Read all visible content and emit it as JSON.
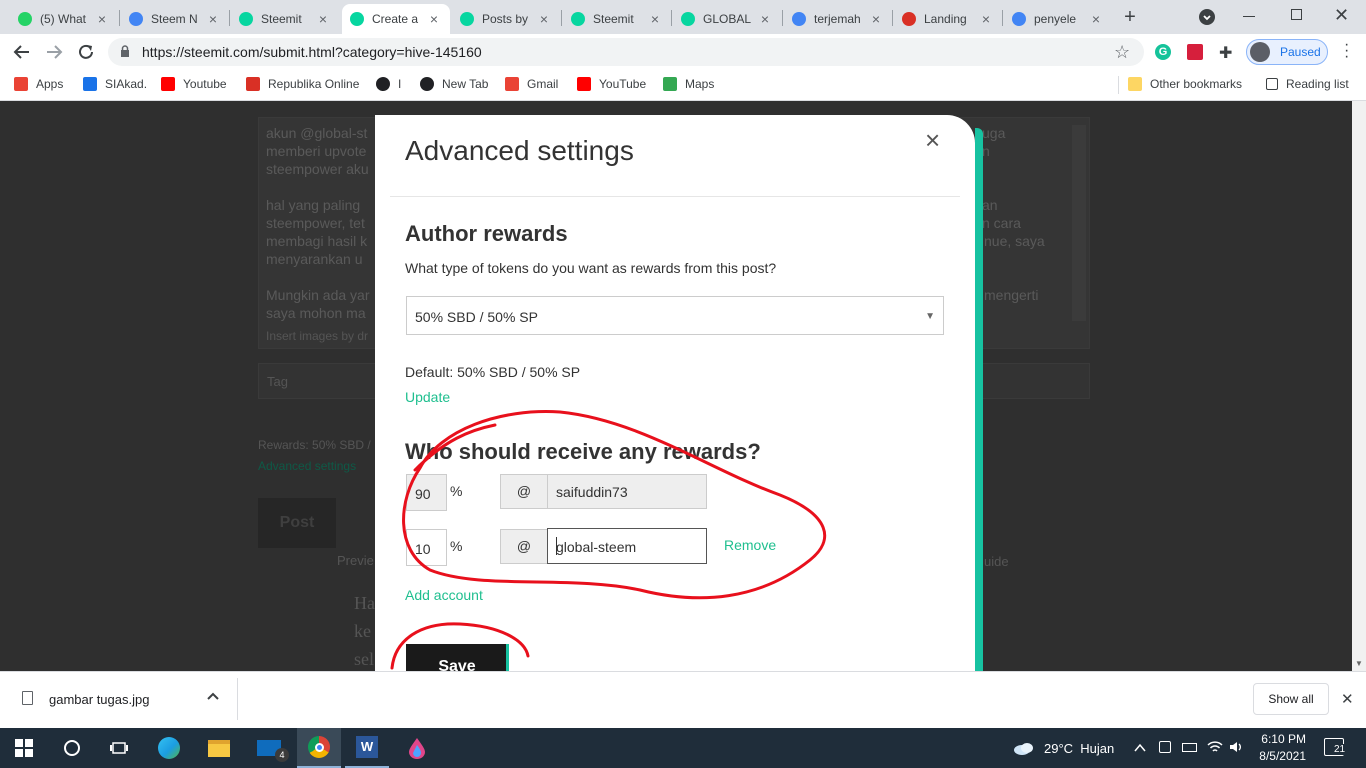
{
  "browser": {
    "tabs": [
      {
        "title": "(5) What",
        "icon": "whatsapp-icon",
        "color": "#25d366",
        "active": false
      },
      {
        "title": "Steem N",
        "icon": "docs-icon",
        "color": "#4285f4",
        "active": false
      },
      {
        "title": "Steemit",
        "icon": "steemit-icon",
        "color": "#07d6a0",
        "active": false
      },
      {
        "title": "Create a",
        "icon": "steemit-icon",
        "color": "#07d6a0",
        "active": true
      },
      {
        "title": "Posts by",
        "icon": "steemit-icon",
        "color": "#07d6a0",
        "active": false
      },
      {
        "title": "Steemit",
        "icon": "steemit-icon",
        "color": "#07d6a0",
        "active": false
      },
      {
        "title": "GLOBAL",
        "icon": "steemit-icon",
        "color": "#07d6a0",
        "active": false
      },
      {
        "title": "terjemah",
        "icon": "google-icon",
        "color": "#4285f4",
        "active": false
      },
      {
        "title": "Landing",
        "icon": "wifi-icon",
        "color": "#d93025",
        "active": false
      },
      {
        "title": "penyele",
        "icon": "google-icon",
        "color": "#4285f4",
        "active": false
      }
    ],
    "new_tab": "+",
    "url": "https://steemit.com/submit.html?category=hive-145160",
    "profile_status": "Paused",
    "bookmarks": [
      {
        "label": "Apps",
        "icon": "apps-icon",
        "color": "#ea4335"
      },
      {
        "label": "SIAkad.",
        "icon": "siakad-icon",
        "color": "#1a73e8"
      },
      {
        "label": "Youtube",
        "icon": "youtube-icon",
        "color": "#ff0000"
      },
      {
        "label": "Republika Online",
        "icon": "republika-icon",
        "color": "#d93025"
      },
      {
        "label": "I",
        "icon": "globe-icon",
        "color": "#202124"
      },
      {
        "label": "New Tab",
        "icon": "globe-icon",
        "color": "#202124"
      },
      {
        "label": "Gmail",
        "icon": "gmail-icon",
        "color": "#ea4335"
      },
      {
        "label": "YouTube",
        "icon": "youtube-icon",
        "color": "#ff0000"
      },
      {
        "label": "Maps",
        "icon": "maps-icon",
        "color": "#34a853"
      }
    ],
    "other_bookmarks": "Other bookmarks",
    "reading_list": "Reading list"
  },
  "background": {
    "editor_lines": [
      "akun @global-st",
      "memberi upvote",
      "steempower aku",
      "hal yang paling",
      "steempower, tet",
      "membagi hasil k",
      "menyarankan u",
      "Mungkin ada yar",
      "saya mohon ma"
    ],
    "editor_right_lines": [
      "uga",
      "n",
      "an",
      "n cara",
      "nue, saya",
      "mengerti"
    ],
    "insert_images": "Insert images by dr",
    "tags_placeholder": "Tag",
    "rewards": "Rewards: 50% SBD /",
    "advanced_settings": "Advanced settings",
    "post_button": "Post",
    "preview": "Previe",
    "guide": "uide",
    "body_text": [
      "Ha",
      "ke",
      "sel"
    ]
  },
  "modal": {
    "title": "Advanced settings",
    "close": "×",
    "author_rewards": {
      "heading": "Author rewards",
      "question": "What type of tokens do you want as rewards from this post?",
      "selected": "50% SBD / 50% SP",
      "default_text": "Default: 50% SBD / 50% SP",
      "update": "Update"
    },
    "beneficiaries": {
      "heading": "Who should receive any rewards?",
      "rows": [
        {
          "percent": "90",
          "account": "saifuddin73",
          "editable": false,
          "remove": ""
        },
        {
          "percent": "10",
          "account": "global-steem",
          "editable": true,
          "remove": "Remove"
        }
      ],
      "percent_sign": "%",
      "at_sign": "@",
      "add_account": "Add account"
    },
    "save": "Save"
  },
  "downloads": {
    "file": "gambar tugas.jpg",
    "show_all": "Show all"
  },
  "taskbar": {
    "weather": "29°C  Hujan",
    "time": "6:10 PM",
    "date": "8/5/2021",
    "notifications": "21"
  },
  "colors": {
    "steemit_green": "#07d6a0",
    "accent_bar": "#17c2a1",
    "annotation_red": "#e8101c",
    "link_green": "#1fbf8f"
  }
}
